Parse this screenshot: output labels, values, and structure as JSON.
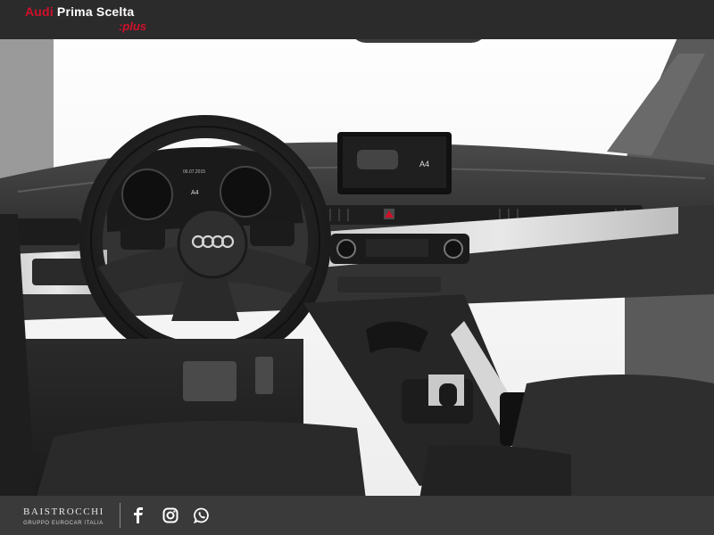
{
  "header": {
    "brand_audi": "Audi",
    "brand_rest": "Prima Scelta",
    "brand_plus": ":plus"
  },
  "infotainment": {
    "model_label": "A4"
  },
  "cluster": {
    "date_text": "06.07.2015",
    "model_label": "A4"
  },
  "footer": {
    "dealer_name": "BAISTROCCHI",
    "dealer_subtitle": "GRUPPO EUROCAR ITALIA",
    "social": [
      {
        "name": "facebook-icon"
      },
      {
        "name": "instagram-icon"
      },
      {
        "name": "whatsapp-icon"
      }
    ]
  },
  "colors": {
    "audi_red": "#d0102b",
    "topbar": "#2b2b2b",
    "footer": "#3a3a3a"
  }
}
